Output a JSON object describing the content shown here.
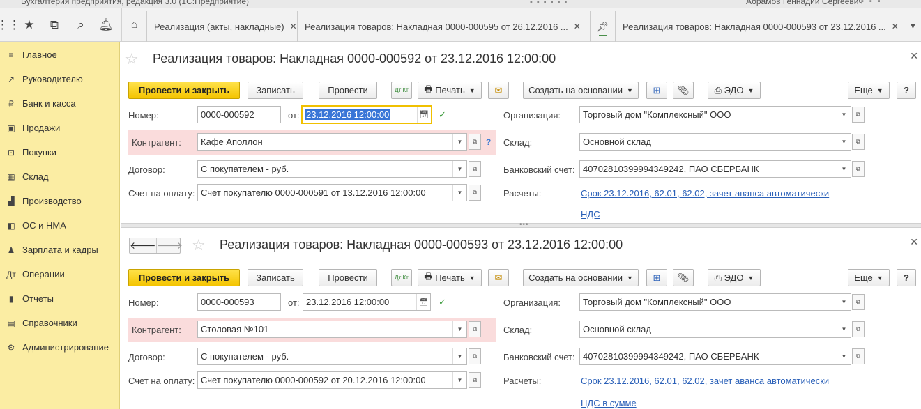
{
  "titlebar": {
    "title": "Бухгалтерия предприятия, редакция 3.0 (1С:Предприятие)",
    "user": "Абрамов Геннадий Сергеевич"
  },
  "topbar": {
    "icons": [
      "apps-icon",
      "star-icon",
      "history-icon",
      "search-icon",
      "bell-icon"
    ]
  },
  "tabs": [
    {
      "label": "Реализация (акты, накладные)"
    },
    {
      "label": "Реализация товаров: Накладная 0000-000595 от 26.12.2016 ..."
    },
    {
      "label": "Реализация товаров: Накладная 0000-000593 от 23.12.2016 ..."
    }
  ],
  "sidebar": {
    "items": [
      {
        "label": "Главное",
        "icon": "≡"
      },
      {
        "label": "Руководителю",
        "icon": "↗"
      },
      {
        "label": "Банк и касса",
        "icon": "₽"
      },
      {
        "label": "Продажи",
        "icon": "▣"
      },
      {
        "label": "Покупки",
        "icon": "⊡"
      },
      {
        "label": "Склад",
        "icon": "▦"
      },
      {
        "label": "Производство",
        "icon": "▟"
      },
      {
        "label": "ОС и НМА",
        "icon": "◧"
      },
      {
        "label": "Зарплата и кадры",
        "icon": "♟"
      },
      {
        "label": "Операции",
        "icon": "Дт"
      },
      {
        "label": "Отчеты",
        "icon": "▮"
      },
      {
        "label": "Справочники",
        "icon": "▤"
      },
      {
        "label": "Администрирование",
        "icon": "⚙"
      }
    ]
  },
  "common": {
    "post_close": "Провести и закрыть",
    "write": "Записать",
    "post": "Провести",
    "print": "Печать",
    "create_basis": "Создать на основании",
    "edo": "ЭДО",
    "more": "Еще",
    "help": "?",
    "dt_kt": "Дт Кт",
    "lbl_number": "Номер:",
    "lbl_from": "от:",
    "lbl_counterparty": "Контрагент:",
    "lbl_contract": "Договор:",
    "lbl_invoice": "Счет на оплату:",
    "lbl_org": "Организация:",
    "lbl_warehouse": "Склад:",
    "lbl_bank": "Банковский счет:",
    "lbl_calc": "Расчеты:"
  },
  "doc1": {
    "title": "Реализация товаров: Накладная 0000-000592 от 23.12.2016 12:00:00",
    "number": "0000-000592",
    "date": "23.12.2016 12:00:00",
    "counterparty": "Кафе Аполлон",
    "contract": "С покупателем - руб.",
    "invoice": "Счет покупателю 0000-000591 от 13.12.2016 12:00:00",
    "org": "Торговый дом \"Комплексный\" ООО",
    "warehouse": "Основной склад",
    "bank": "40702810399994349242, ПАО СБЕРБАНК",
    "calc_link": "Срок 23.12.2016, 62.01, 62.02, зачет аванса автоматически",
    "vat_link": "НДС"
  },
  "doc2": {
    "title": "Реализация товаров: Накладная 0000-000593 от 23.12.2016 12:00:00",
    "number": "0000-000593",
    "date": "23.12.2016 12:00:00",
    "counterparty": "Столовая №101",
    "contract": "С покупателем - руб.",
    "invoice": "Счет покупателю 0000-000592 от 20.12.2016 12:00:00",
    "org": "Торговый дом \"Комплексный\" ООО",
    "warehouse": "Основной склад",
    "bank": "40702810399994349242, ПАО СБЕРБАНК",
    "calc_link": "Срок 23.12.2016, 62.01, 62.02, зачет аванса автоматически",
    "vat_link": "НДС в сумме"
  }
}
